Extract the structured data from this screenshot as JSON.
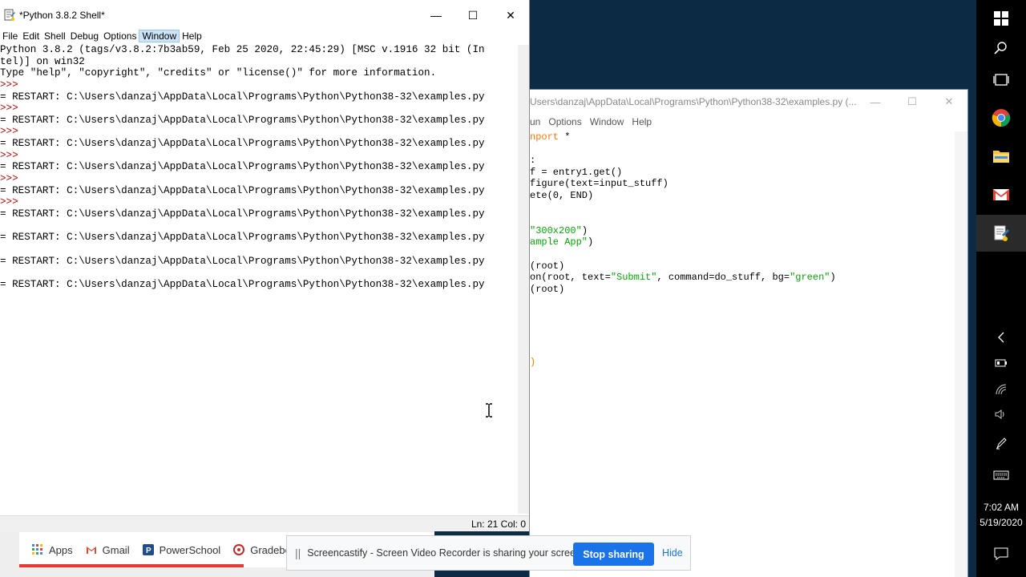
{
  "editor": {
    "title": "Users\\danzaj\\AppData\\Local\\Programs\\Python\\Python38-32\\examples.py (...",
    "menu": [
      "un",
      "Options",
      "Window",
      "Help"
    ],
    "code_lines": [
      {
        "parts": [
          {
            "t": "nport",
            "c": "kw"
          },
          {
            "t": " *",
            "c": ""
          }
        ]
      },
      {
        "parts": [
          {
            "t": "",
            "c": ""
          }
        ]
      },
      {
        "parts": [
          {
            "t": ":",
            "c": ""
          }
        ]
      },
      {
        "parts": [
          {
            "t": "f = entry1.get()",
            "c": ""
          }
        ]
      },
      {
        "parts": [
          {
            "t": "figure(text=input_stuff)",
            "c": ""
          }
        ]
      },
      {
        "parts": [
          {
            "t": "ete(0, END)",
            "c": ""
          }
        ]
      },
      {
        "parts": [
          {
            "t": "",
            "c": ""
          }
        ]
      },
      {
        "parts": [
          {
            "t": "",
            "c": ""
          }
        ]
      },
      {
        "parts": [
          {
            "t": "\"300x200\"",
            "c": "str"
          },
          {
            "t": ")",
            "c": ""
          }
        ]
      },
      {
        "parts": [
          {
            "t": "ample App\"",
            "c": "str"
          },
          {
            "t": ")",
            "c": ""
          }
        ]
      },
      {
        "parts": [
          {
            "t": "",
            "c": ""
          }
        ]
      },
      {
        "parts": [
          {
            "t": "(root)",
            "c": ""
          }
        ]
      },
      {
        "parts": [
          {
            "t": "on(root, text=",
            "c": ""
          },
          {
            "t": "\"Submit\"",
            "c": "str"
          },
          {
            "t": ", command=do_stuff, bg=",
            "c": ""
          },
          {
            "t": "\"green\"",
            "c": "str"
          },
          {
            "t": ")",
            "c": ""
          }
        ]
      },
      {
        "parts": [
          {
            "t": "(root)",
            "c": ""
          }
        ]
      }
    ]
  },
  "shell": {
    "title": "*Python 3.8.2 Shell*",
    "menu": [
      "File",
      "Edit",
      "Shell",
      "Debug",
      "Options",
      "Window",
      "Help"
    ],
    "active_menu": "Window",
    "lines": [
      {
        "t": "Python 3.8.2 (tags/v3.8.2:7b3ab59, Feb 25 2020, 22:45:29) [MSC v.1916 32 bit (In",
        "c": ""
      },
      {
        "t": "tel)] on win32",
        "c": ""
      },
      {
        "t": "Type \"help\", \"copyright\", \"credits\" or \"license()\" for more information.",
        "c": ""
      },
      {
        "t": ">>>",
        "c": "prompt"
      },
      {
        "t": "= RESTART: C:\\Users\\danzaj\\AppData\\Local\\Programs\\Python\\Python38-32\\examples.py",
        "c": ""
      },
      {
        "t": ">>>",
        "c": "prompt"
      },
      {
        "t": "= RESTART: C:\\Users\\danzaj\\AppData\\Local\\Programs\\Python\\Python38-32\\examples.py",
        "c": ""
      },
      {
        "t": ">>>",
        "c": "prompt"
      },
      {
        "t": "= RESTART: C:\\Users\\danzaj\\AppData\\Local\\Programs\\Python\\Python38-32\\examples.py",
        "c": ""
      },
      {
        "t": ">>>",
        "c": "prompt"
      },
      {
        "t": "= RESTART: C:\\Users\\danzaj\\AppData\\Local\\Programs\\Python\\Python38-32\\examples.py",
        "c": ""
      },
      {
        "t": ">>>",
        "c": "prompt"
      },
      {
        "t": "= RESTART: C:\\Users\\danzaj\\AppData\\Local\\Programs\\Python\\Python38-32\\examples.py",
        "c": ""
      },
      {
        "t": ">>>",
        "c": "prompt"
      },
      {
        "t": "= RESTART: C:\\Users\\danzaj\\AppData\\Local\\Programs\\Python\\Python38-32\\examples.py",
        "c": ""
      },
      {
        "t": "",
        "c": ""
      },
      {
        "t": "= RESTART: C:\\Users\\danzaj\\AppData\\Local\\Programs\\Python\\Python38-32\\examples.py",
        "c": ""
      },
      {
        "t": "",
        "c": ""
      },
      {
        "t": "= RESTART: C:\\Users\\danzaj\\AppData\\Local\\Programs\\Python\\Python38-32\\examples.py",
        "c": ""
      },
      {
        "t": "",
        "c": ""
      },
      {
        "t": "= RESTART: C:\\Users\\danzaj\\AppData\\Local\\Programs\\Python\\Python38-32\\examples.py",
        "c": ""
      }
    ],
    "status": "Ln: 21  Col: 0"
  },
  "bookmarks": [
    {
      "label": "Apps",
      "icon": "apps-grid-icon"
    },
    {
      "label": "Gmail",
      "icon": "gmail-icon"
    },
    {
      "label": "PowerSchool",
      "icon": "powerschool-icon"
    },
    {
      "label": "Gradebo",
      "icon": "gradebook-icon"
    }
  ],
  "banner": {
    "message": "Screencastify - Screen Video Recorder is sharing your screen.",
    "stop_label": "Stop sharing",
    "hide_label": "Hide"
  },
  "taskbar": {
    "time": "7:02 AM",
    "date": "5/19/2020"
  },
  "colors": {
    "keyword": "#ff7700",
    "string": "#00aa00",
    "prompt": "#c00000",
    "accent": "#1a73e8"
  }
}
